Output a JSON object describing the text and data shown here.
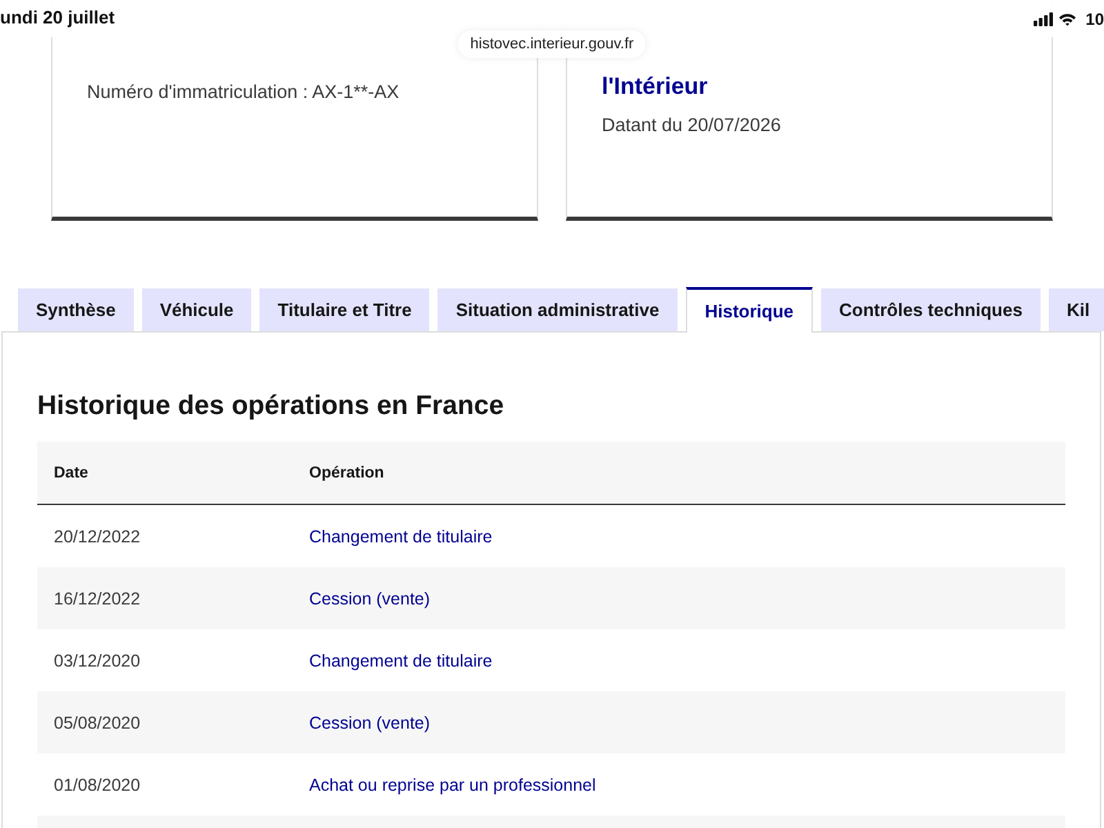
{
  "status_bar": {
    "date": "undi 20 juillet",
    "battery": "10"
  },
  "address_bar": {
    "url": "histovec.interieur.gouv.fr"
  },
  "cards": [
    {
      "lines": [
        {
          "kind": "text",
          "text": "Numéro d'immatriculation : AX-1**-AX"
        }
      ]
    },
    {
      "lines": [
        {
          "kind": "title",
          "text": "l'Intérieur"
        },
        {
          "kind": "text",
          "text": "Datant du 20/07/2026"
        }
      ]
    }
  ],
  "tabs": [
    {
      "label": "Synthèse",
      "selected": false
    },
    {
      "label": "Véhicule",
      "selected": false
    },
    {
      "label": "Titulaire et Titre",
      "selected": false
    },
    {
      "label": "Situation administrative",
      "selected": false
    },
    {
      "label": "Historique",
      "selected": true
    },
    {
      "label": "Contrôles techniques",
      "selected": false
    },
    {
      "label": "Kil",
      "selected": false
    }
  ],
  "panel": {
    "heading": "Historique des opérations en France",
    "table": {
      "columns": [
        "Date",
        "Opération"
      ],
      "rows": [
        [
          "20/12/2022",
          "Changement de titulaire"
        ],
        [
          "16/12/2022",
          "Cession (vente)"
        ],
        [
          "03/12/2020",
          "Changement de titulaire"
        ],
        [
          "05/08/2020",
          "Cession (vente)"
        ],
        [
          "01/08/2020",
          "Achat ou reprise par un professionnel"
        ]
      ]
    }
  }
}
